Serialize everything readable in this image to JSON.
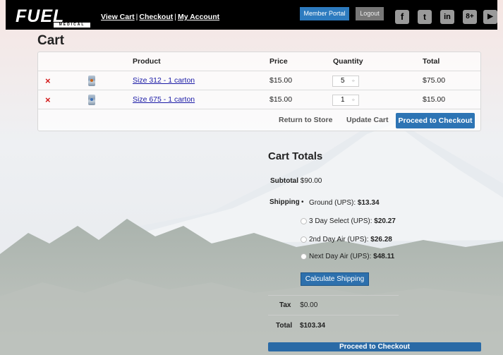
{
  "header": {
    "logo_text": "FUEL",
    "logo_sub": "MEDICAL",
    "nav": [
      "View Cart",
      "Checkout",
      "My Account"
    ],
    "nav_separator": "|",
    "member_portal": "Member Portal",
    "logout": "Logout",
    "social": [
      {
        "name": "facebook-icon",
        "glyph": "f"
      },
      {
        "name": "twitter-icon",
        "glyph": "t"
      },
      {
        "name": "linkedin-icon",
        "glyph": "in"
      },
      {
        "name": "googleplus-icon",
        "glyph": "8+"
      },
      {
        "name": "youtube-icon",
        "glyph": "▶"
      }
    ]
  },
  "cart": {
    "title": "Cart",
    "columns": {
      "product": "Product",
      "price": "Price",
      "quantity": "Quantity",
      "total": "Total"
    },
    "remove_glyph": "×",
    "items": [
      {
        "product": "Size 312 - 1 carton",
        "price": "$15.00",
        "quantity": "5",
        "total": "$75.00"
      },
      {
        "product": "Size 675 - 1 carton",
        "price": "$15.00",
        "quantity": "1",
        "total": "$15.00"
      }
    ],
    "spinner_glyph": "÷",
    "buttons": {
      "return": "Return to Store",
      "update": "Update Cart",
      "checkout": "Proceed to Checkout"
    }
  },
  "totals": {
    "title": "Cart Totals",
    "subtotal_label": "Subtotal",
    "subtotal_value": "$90.00",
    "shipping_label": "Shipping",
    "shipping_options": [
      {
        "label": "Ground (UPS):",
        "price": "$13.34",
        "selected": true
      },
      {
        "label": "3 Day Select (UPS):",
        "price": "$20.27",
        "selected": false
      },
      {
        "label": "2nd Day Air (UPS):",
        "price": "$26.28",
        "selected": false
      },
      {
        "label": "Next Day Air (UPS):",
        "price": "$48.11",
        "selected": false
      }
    ],
    "calculate_shipping": "Calculate Shipping",
    "tax_label": "Tax",
    "tax_value": "$0.00",
    "total_label": "Total",
    "total_value": "$103.34",
    "proceed": "Proceed to Checkout"
  }
}
